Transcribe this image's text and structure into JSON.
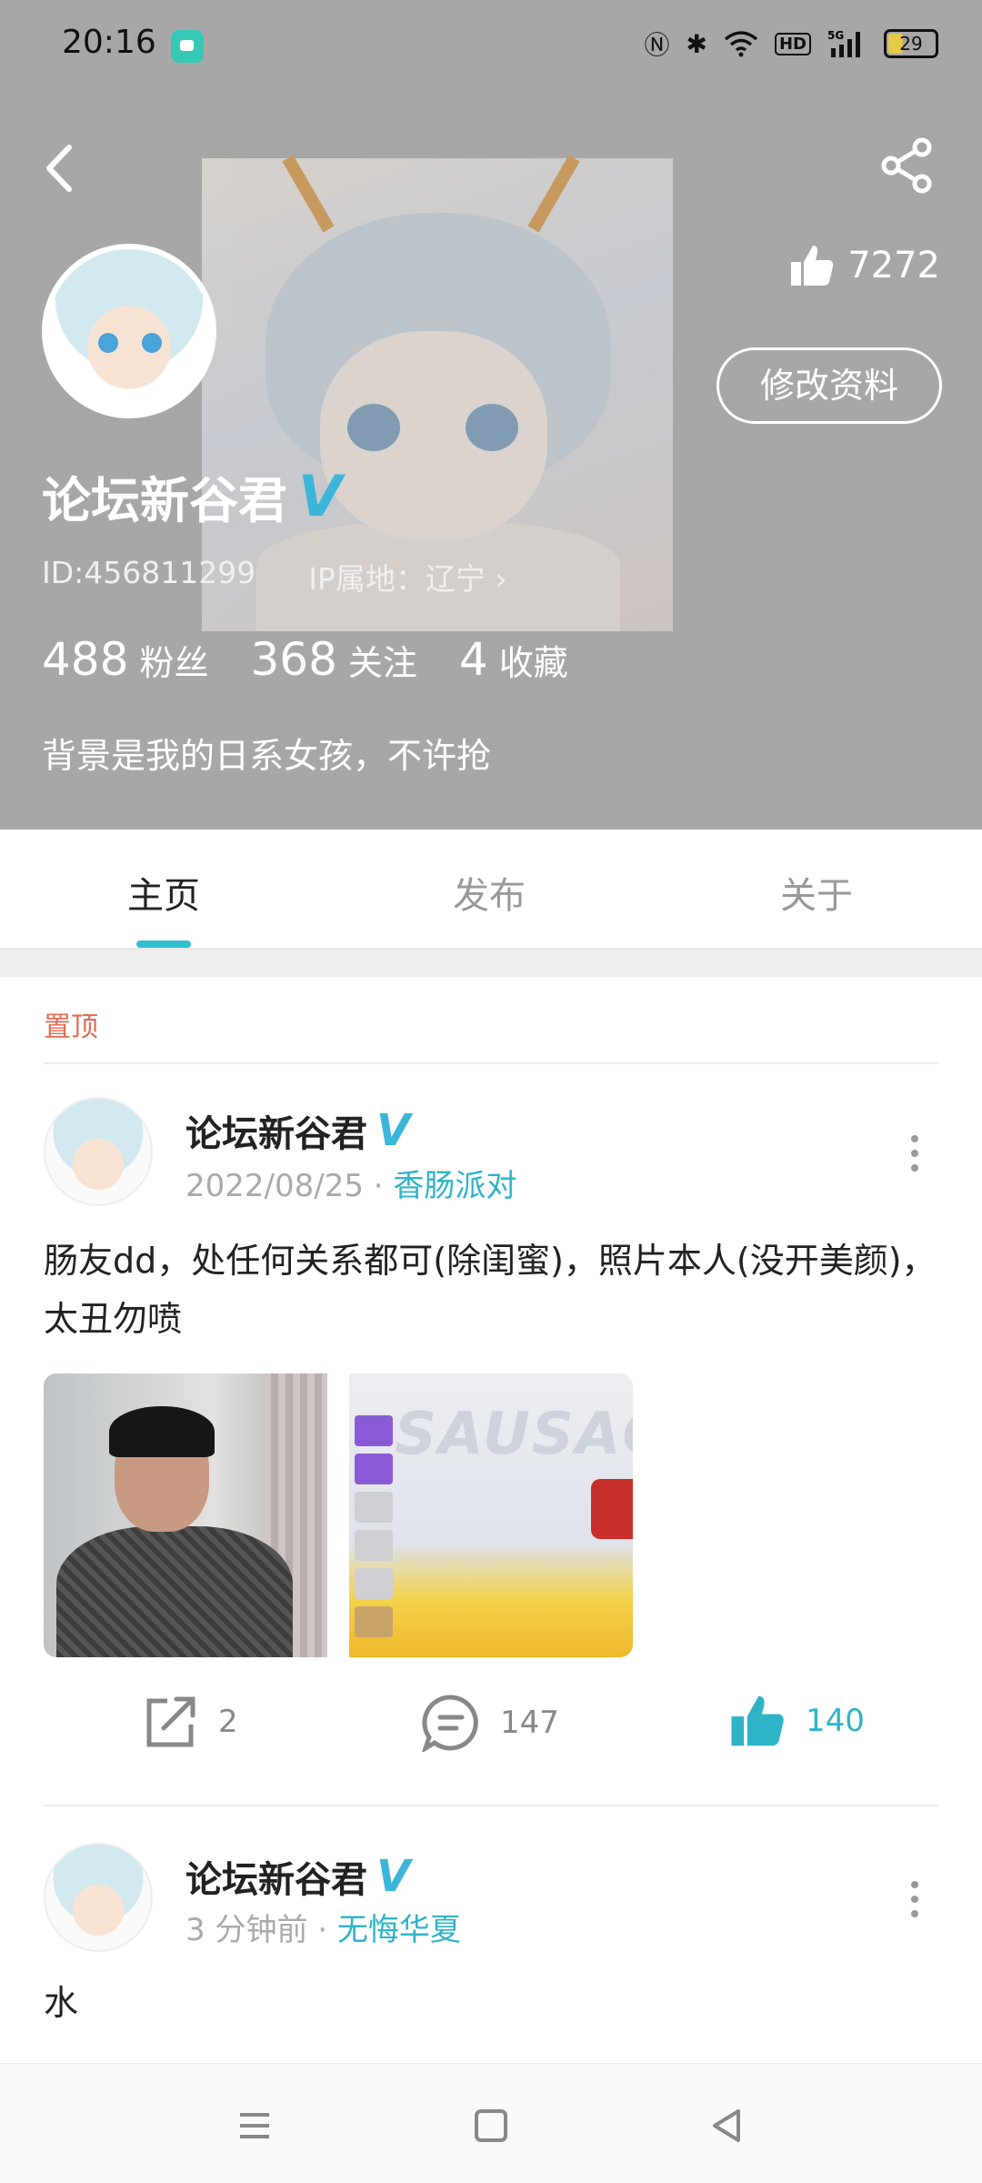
{
  "status_bar": {
    "time": "20:16",
    "battery": "29",
    "network": "5G",
    "hd": "HD"
  },
  "profile": {
    "likes": "7272",
    "edit_label": "修改资料",
    "name": "论坛新谷君",
    "verified": "V",
    "id_text": "ID:456811299",
    "ip_text": "IP属地：辽宁 ›",
    "stats": [
      {
        "value": "488",
        "label": "粉丝"
      },
      {
        "value": "368",
        "label": "关注"
      },
      {
        "value": "4",
        "label": "收藏"
      }
    ],
    "bio": "背景是我的日系女孩，不许抢"
  },
  "tabs": [
    {
      "label": "主页",
      "active": true
    },
    {
      "label": "发布",
      "active": false
    },
    {
      "label": "关于",
      "active": false
    }
  ],
  "pinned_label": "置顶",
  "posts": [
    {
      "author": "论坛新谷君",
      "verified": "V",
      "time": "2022/08/25",
      "sep": "·",
      "tag": "香肠派对",
      "text": "肠友dd，处任何关系都可(除闺蜜)，照片本人(没开美颜)，太丑勿喷",
      "shares": "2",
      "comments": "147",
      "likes": "140",
      "image_watermark": "SAUSAG"
    },
    {
      "author": "论坛新谷君",
      "verified": "V",
      "time": "3 分钟前",
      "sep": "·",
      "tag": "无悔华夏",
      "text": "水"
    }
  ],
  "colors": {
    "accent": "#2fbfce",
    "pinned": "#e36b55",
    "header_bg": "#a7a7a7"
  }
}
